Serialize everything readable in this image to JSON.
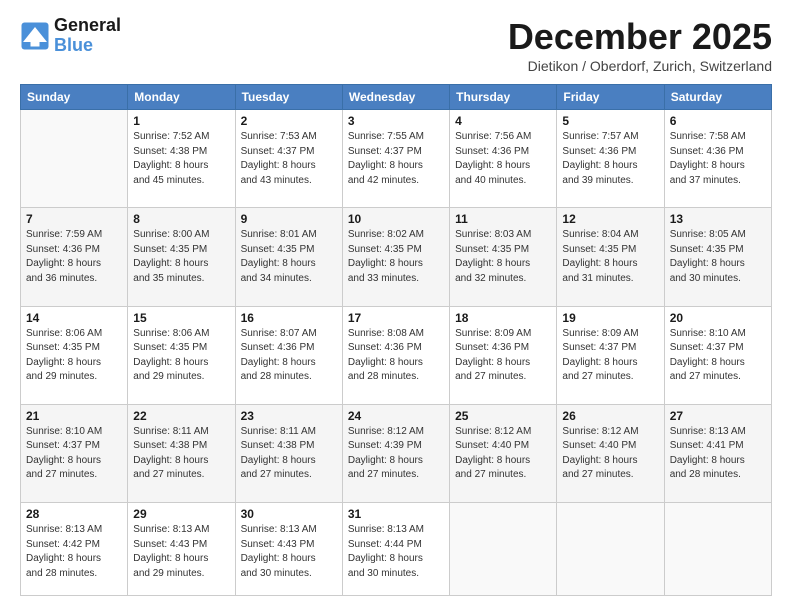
{
  "logo": {
    "line1": "General",
    "line2": "Blue"
  },
  "title": "December 2025",
  "location": "Dietikon / Oberdorf, Zurich, Switzerland",
  "headers": [
    "Sunday",
    "Monday",
    "Tuesday",
    "Wednesday",
    "Thursday",
    "Friday",
    "Saturday"
  ],
  "weeks": [
    [
      {
        "day": "",
        "info": ""
      },
      {
        "day": "1",
        "info": "Sunrise: 7:52 AM\nSunset: 4:38 PM\nDaylight: 8 hours\nand 45 minutes."
      },
      {
        "day": "2",
        "info": "Sunrise: 7:53 AM\nSunset: 4:37 PM\nDaylight: 8 hours\nand 43 minutes."
      },
      {
        "day": "3",
        "info": "Sunrise: 7:55 AM\nSunset: 4:37 PM\nDaylight: 8 hours\nand 42 minutes."
      },
      {
        "day": "4",
        "info": "Sunrise: 7:56 AM\nSunset: 4:36 PM\nDaylight: 8 hours\nand 40 minutes."
      },
      {
        "day": "5",
        "info": "Sunrise: 7:57 AM\nSunset: 4:36 PM\nDaylight: 8 hours\nand 39 minutes."
      },
      {
        "day": "6",
        "info": "Sunrise: 7:58 AM\nSunset: 4:36 PM\nDaylight: 8 hours\nand 37 minutes."
      }
    ],
    [
      {
        "day": "7",
        "info": "Sunrise: 7:59 AM\nSunset: 4:36 PM\nDaylight: 8 hours\nand 36 minutes."
      },
      {
        "day": "8",
        "info": "Sunrise: 8:00 AM\nSunset: 4:35 PM\nDaylight: 8 hours\nand 35 minutes."
      },
      {
        "day": "9",
        "info": "Sunrise: 8:01 AM\nSunset: 4:35 PM\nDaylight: 8 hours\nand 34 minutes."
      },
      {
        "day": "10",
        "info": "Sunrise: 8:02 AM\nSunset: 4:35 PM\nDaylight: 8 hours\nand 33 minutes."
      },
      {
        "day": "11",
        "info": "Sunrise: 8:03 AM\nSunset: 4:35 PM\nDaylight: 8 hours\nand 32 minutes."
      },
      {
        "day": "12",
        "info": "Sunrise: 8:04 AM\nSunset: 4:35 PM\nDaylight: 8 hours\nand 31 minutes."
      },
      {
        "day": "13",
        "info": "Sunrise: 8:05 AM\nSunset: 4:35 PM\nDaylight: 8 hours\nand 30 minutes."
      }
    ],
    [
      {
        "day": "14",
        "info": "Sunrise: 8:06 AM\nSunset: 4:35 PM\nDaylight: 8 hours\nand 29 minutes."
      },
      {
        "day": "15",
        "info": "Sunrise: 8:06 AM\nSunset: 4:35 PM\nDaylight: 8 hours\nand 29 minutes."
      },
      {
        "day": "16",
        "info": "Sunrise: 8:07 AM\nSunset: 4:36 PM\nDaylight: 8 hours\nand 28 minutes."
      },
      {
        "day": "17",
        "info": "Sunrise: 8:08 AM\nSunset: 4:36 PM\nDaylight: 8 hours\nand 28 minutes."
      },
      {
        "day": "18",
        "info": "Sunrise: 8:09 AM\nSunset: 4:36 PM\nDaylight: 8 hours\nand 27 minutes."
      },
      {
        "day": "19",
        "info": "Sunrise: 8:09 AM\nSunset: 4:37 PM\nDaylight: 8 hours\nand 27 minutes."
      },
      {
        "day": "20",
        "info": "Sunrise: 8:10 AM\nSunset: 4:37 PM\nDaylight: 8 hours\nand 27 minutes."
      }
    ],
    [
      {
        "day": "21",
        "info": "Sunrise: 8:10 AM\nSunset: 4:37 PM\nDaylight: 8 hours\nand 27 minutes."
      },
      {
        "day": "22",
        "info": "Sunrise: 8:11 AM\nSunset: 4:38 PM\nDaylight: 8 hours\nand 27 minutes."
      },
      {
        "day": "23",
        "info": "Sunrise: 8:11 AM\nSunset: 4:38 PM\nDaylight: 8 hours\nand 27 minutes."
      },
      {
        "day": "24",
        "info": "Sunrise: 8:12 AM\nSunset: 4:39 PM\nDaylight: 8 hours\nand 27 minutes."
      },
      {
        "day": "25",
        "info": "Sunrise: 8:12 AM\nSunset: 4:40 PM\nDaylight: 8 hours\nand 27 minutes."
      },
      {
        "day": "26",
        "info": "Sunrise: 8:12 AM\nSunset: 4:40 PM\nDaylight: 8 hours\nand 27 minutes."
      },
      {
        "day": "27",
        "info": "Sunrise: 8:13 AM\nSunset: 4:41 PM\nDaylight: 8 hours\nand 28 minutes."
      }
    ],
    [
      {
        "day": "28",
        "info": "Sunrise: 8:13 AM\nSunset: 4:42 PM\nDaylight: 8 hours\nand 28 minutes."
      },
      {
        "day": "29",
        "info": "Sunrise: 8:13 AM\nSunset: 4:43 PM\nDaylight: 8 hours\nand 29 minutes."
      },
      {
        "day": "30",
        "info": "Sunrise: 8:13 AM\nSunset: 4:43 PM\nDaylight: 8 hours\nand 30 minutes."
      },
      {
        "day": "31",
        "info": "Sunrise: 8:13 AM\nSunset: 4:44 PM\nDaylight: 8 hours\nand 30 minutes."
      },
      {
        "day": "",
        "info": ""
      },
      {
        "day": "",
        "info": ""
      },
      {
        "day": "",
        "info": ""
      }
    ]
  ]
}
